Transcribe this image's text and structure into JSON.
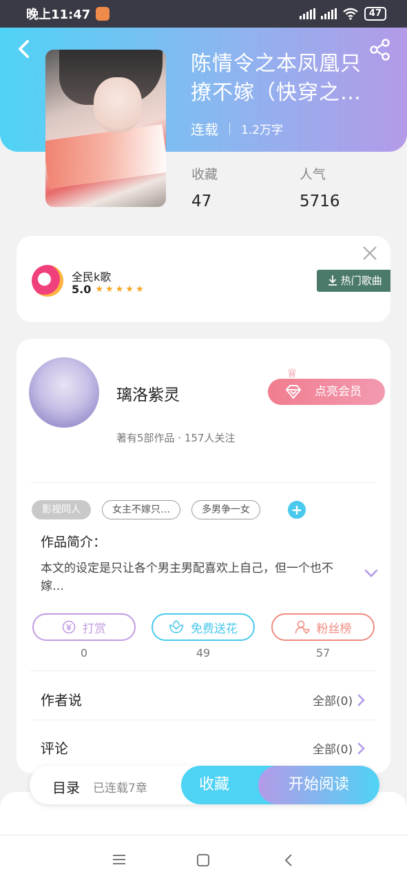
{
  "status_bar": {
    "time": "晚上11:47",
    "battery": "47"
  },
  "book": {
    "title": "陈情令之本凤凰只撩不嫁（快穿之…",
    "status": "连载",
    "word_count": "1.2万字",
    "stats": [
      {
        "label": "收藏",
        "value": "47"
      },
      {
        "label": "人气",
        "value": "5716"
      }
    ]
  },
  "ad": {
    "app_name": "全民k歌",
    "rating": "5.0",
    "stars": "★★★★★",
    "button_label": "热门歌曲"
  },
  "author": {
    "name": "璃洛紫灵",
    "info": "著有5部作品 · 157人关注",
    "vip_label": "点亮会员"
  },
  "tags": [
    "影视同人",
    "女主不嫁只…",
    "多男争一女"
  ],
  "tag_add": "+",
  "intro": {
    "label": "作品简介：",
    "text": "本文的设定是只让各个男主男配喜欢上自己，但一个也不嫁…"
  },
  "actions": [
    {
      "label": "打赏",
      "count": "0",
      "color": "#c39be0",
      "icon": "yen-coin-icon"
    },
    {
      "label": "免费送花",
      "count": "49",
      "color": "#49c9ee",
      "icon": "flower-icon"
    },
    {
      "label": "粉丝榜",
      "count": "57",
      "color": "#ef8b80",
      "icon": "fan-user-icon"
    }
  ],
  "rows": [
    {
      "label": "作者说",
      "right": "全部(0)"
    },
    {
      "label": "评论",
      "right": "全部(0)"
    }
  ],
  "bottom_bar": {
    "toc_label": "目录",
    "toc_info": "已连载7章",
    "fav_label": "收藏",
    "read_label": "开始阅读"
  },
  "colors": {
    "accent_cyan": "#4fd3f5",
    "accent_purple": "#b49ae8",
    "vip_pink": "#f17d8f"
  }
}
